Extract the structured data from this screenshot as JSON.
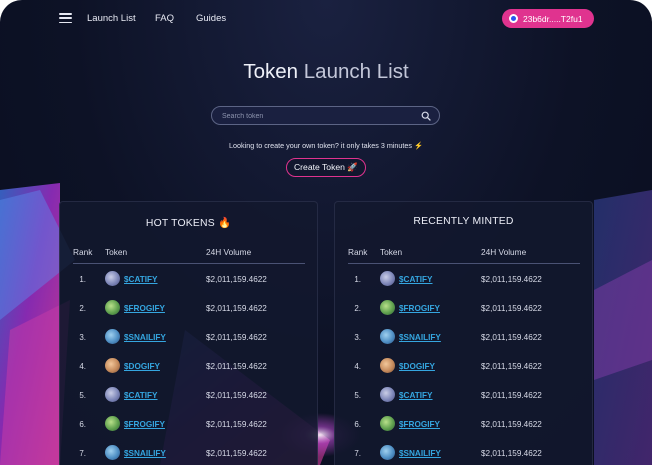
{
  "nav": {
    "links": [
      "Launch List",
      "FAQ",
      "Guides"
    ],
    "wallet_label": "23b6dr.....T2fu1"
  },
  "hero": {
    "title_main": "Token",
    "title_light": "Launch List",
    "search_placeholder": "Search token",
    "promo_text": "Looking to create your own token? it only takes 3 minutes ⚡",
    "create_label": "Create Token 🚀"
  },
  "hot": {
    "title": "HOT TOKENS 🔥",
    "headers": [
      "Rank",
      "Token",
      "24H Volume"
    ],
    "rows": [
      {
        "rank": "1.",
        "token": "$CATIFY",
        "volume": "$2,011,159.4622",
        "icon": "cat"
      },
      {
        "rank": "2.",
        "token": "$FROGIFY",
        "volume": "$2,011,159.4622",
        "icon": "frog"
      },
      {
        "rank": "3.",
        "token": "$SNAILIFY",
        "volume": "$2,011,159.4622",
        "icon": "snail"
      },
      {
        "rank": "4.",
        "token": "$DOGIFY",
        "volume": "$2,011,159.4622",
        "icon": "dog"
      },
      {
        "rank": "5.",
        "token": "$CATIFY",
        "volume": "$2,011,159.4622",
        "icon": "cat"
      },
      {
        "rank": "6.",
        "token": "$FROGIFY",
        "volume": "$2,011,159.4622",
        "icon": "frog"
      },
      {
        "rank": "7.",
        "token": "$SNAILIFY",
        "volume": "$2,011,159.4622",
        "icon": "snail"
      }
    ]
  },
  "recent": {
    "title": "RECENTLY MINTED",
    "headers": [
      "Rank",
      "Token",
      "24H Volume"
    ],
    "rows": [
      {
        "rank": "1.",
        "token": "$CATIFY",
        "volume": "$2,011,159.4622",
        "icon": "cat"
      },
      {
        "rank": "2.",
        "token": "$FROGIFY",
        "volume": "$2,011,159.4622",
        "icon": "frog"
      },
      {
        "rank": "3.",
        "token": "$SNAILIFY",
        "volume": "$2,011,159.4622",
        "icon": "snail"
      },
      {
        "rank": "4.",
        "token": "$DOGIFY",
        "volume": "$2,011,159.4622",
        "icon": "dog"
      },
      {
        "rank": "5.",
        "token": "$CATIFY",
        "volume": "$2,011,159.4622",
        "icon": "cat"
      },
      {
        "rank": "6.",
        "token": "$FROGIFY",
        "volume": "$2,011,159.4622",
        "icon": "frog"
      },
      {
        "rank": "7.",
        "token": "$SNAILIFY",
        "volume": "$2,011,159.4622",
        "icon": "snail"
      }
    ]
  },
  "colors": {
    "accent": "#e0338f",
    "link": "#35a6e0",
    "background": "#0d1226"
  }
}
